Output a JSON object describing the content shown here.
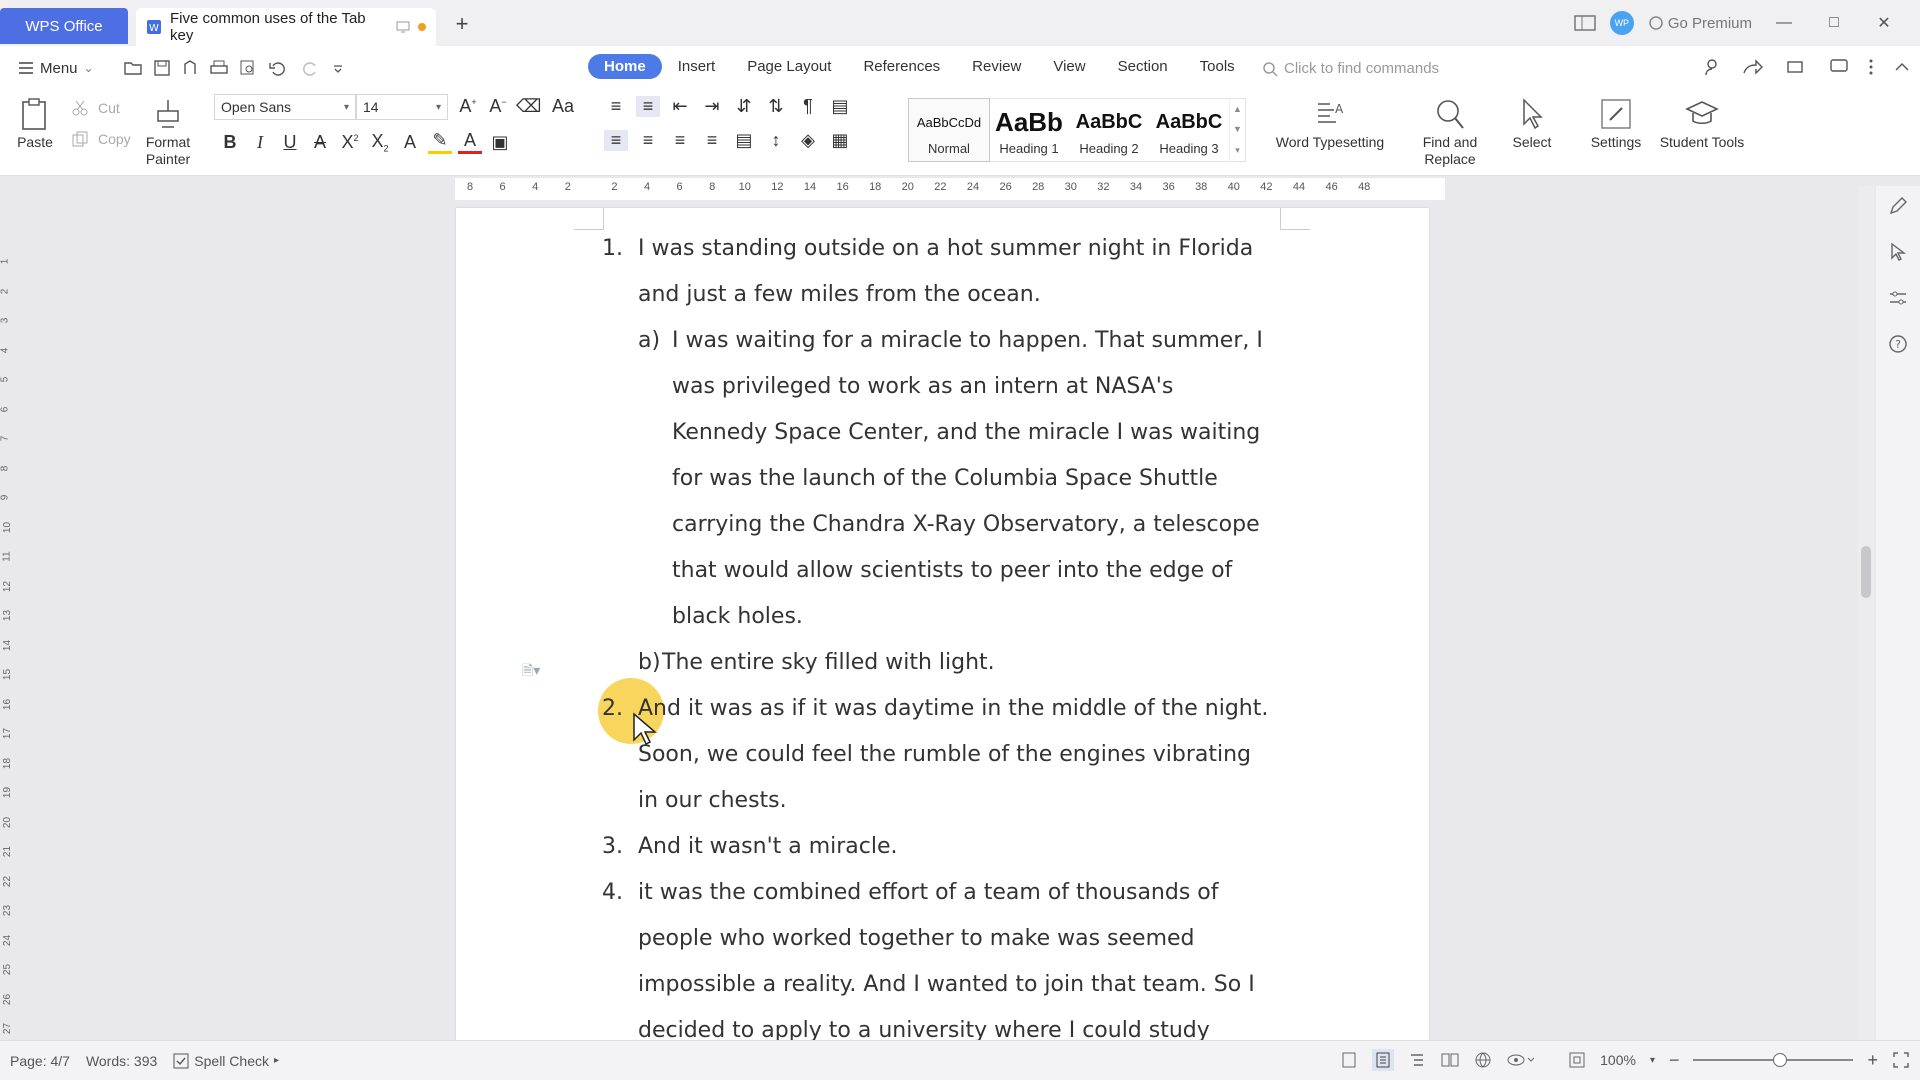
{
  "titlebar": {
    "app_tab": "WPS Office",
    "doc_tab": "Five common uses of the Tab key",
    "premium": "Go Premium",
    "avatar_text": "WP"
  },
  "menu": {
    "menu_label": "Menu",
    "tabs": [
      "Home",
      "Insert",
      "Page Layout",
      "References",
      "Review",
      "View",
      "Section",
      "Tools"
    ],
    "active_tab": "Home",
    "find_placeholder": "Click to find commands"
  },
  "ribbon": {
    "paste": "Paste",
    "cut": "Cut",
    "copy": "Copy",
    "format_painter_1": "Format",
    "format_painter_2": "Painter",
    "font_name": "Open Sans",
    "font_size": "14",
    "styles": [
      {
        "preview": "AaBbCcDd",
        "label": "Normal"
      },
      {
        "preview": "AaBb",
        "label": "Heading 1"
      },
      {
        "preview": "AaBbC",
        "label": "Heading 2"
      },
      {
        "preview": "AaBbC",
        "label": "Heading 3"
      }
    ],
    "word_typesetting": "Word Typesetting",
    "find_replace_1": "Find and",
    "find_replace_2": "Replace",
    "select": "Select",
    "settings": "Settings",
    "student_tools": "Student Tools"
  },
  "ruler": {
    "ticks": [
      "8",
      "6",
      "4",
      "2",
      "2",
      "4",
      "6",
      "8",
      "10",
      "12",
      "14",
      "16",
      "18",
      "20",
      "22",
      "24",
      "26",
      "28",
      "30",
      "32",
      "34",
      "36",
      "38",
      "40",
      "42",
      "44",
      "46",
      "48"
    ],
    "vticks": [
      "1",
      "2",
      "3",
      "4",
      "5",
      "6",
      "7",
      "8",
      "9",
      "10",
      "11",
      "12",
      "13",
      "14",
      "15",
      "16",
      "17",
      "18",
      "19",
      "20",
      "21",
      "22",
      "23",
      "24",
      "25",
      "26",
      "27"
    ]
  },
  "document": {
    "item1_num": "1.",
    "item1": "I was standing outside on a hot summer night in Florida and just a few miles from the ocean.",
    "sub_a_num": "a)",
    "sub_a": "I was waiting for a miracle to happen. That summer, I was privileged to work as an intern at NASA's Kennedy Space Center, and the miracle I was waiting for was the launch of the Columbia Space Shuttle carrying the Chandra X-Ray Observatory, a telescope that would allow scientists to peer into the edge of black holes.",
    "sub_b_num": "b)",
    "sub_b": "The entire sky filled with light.",
    "item2_num": "2.",
    "item2": "And it was as if it was daytime in the middle of the night. Soon, we could feel the rumble of the engines vibrating in our chests.",
    "item3_num": "3.",
    "item3": " And it wasn't a miracle.",
    "item4_num": "4.",
    "item4": "it was the combined effort of a team of thousands of people who worked together to make was seemed impossible a reality. And I wanted to join that team. So I decided to apply to a university where I could study"
  },
  "status": {
    "page": "Page: 4/7",
    "words": "Words: 393",
    "spell_check": "Spell Check",
    "zoom": "100%"
  }
}
